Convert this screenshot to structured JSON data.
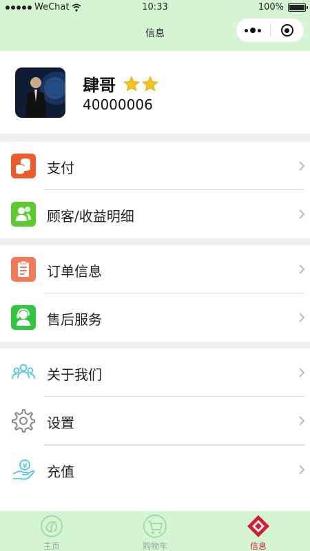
{
  "status_bar": {
    "carrier": "WeChat",
    "time": "10:33",
    "battery": "100%"
  },
  "nav": {
    "title": "信息"
  },
  "profile": {
    "name": "肆哥",
    "id": "40000006",
    "stars": 2
  },
  "menu": [
    {
      "label": "支付"
    },
    {
      "label": "顾客/收益明细"
    },
    {
      "label": "订单信息"
    },
    {
      "label": "售后服务"
    },
    {
      "label": "关于我们"
    },
    {
      "label": "设置"
    },
    {
      "label": "充值"
    }
  ],
  "tabs": [
    {
      "label": "主页"
    },
    {
      "label": "购物车"
    },
    {
      "label": "信息"
    }
  ],
  "colors": {
    "header_bg": "#d4f5d2",
    "active_tab": "#d61b2f",
    "pay_icon": "#f05a2a",
    "customer_icon": "#5ccb2f",
    "order_icon": "#f07a5a",
    "service_icon": "#2ec73d",
    "about_icon": "#5cc8e8",
    "settings_icon": "#888888",
    "recharge_icon": "#5cc8e8"
  }
}
